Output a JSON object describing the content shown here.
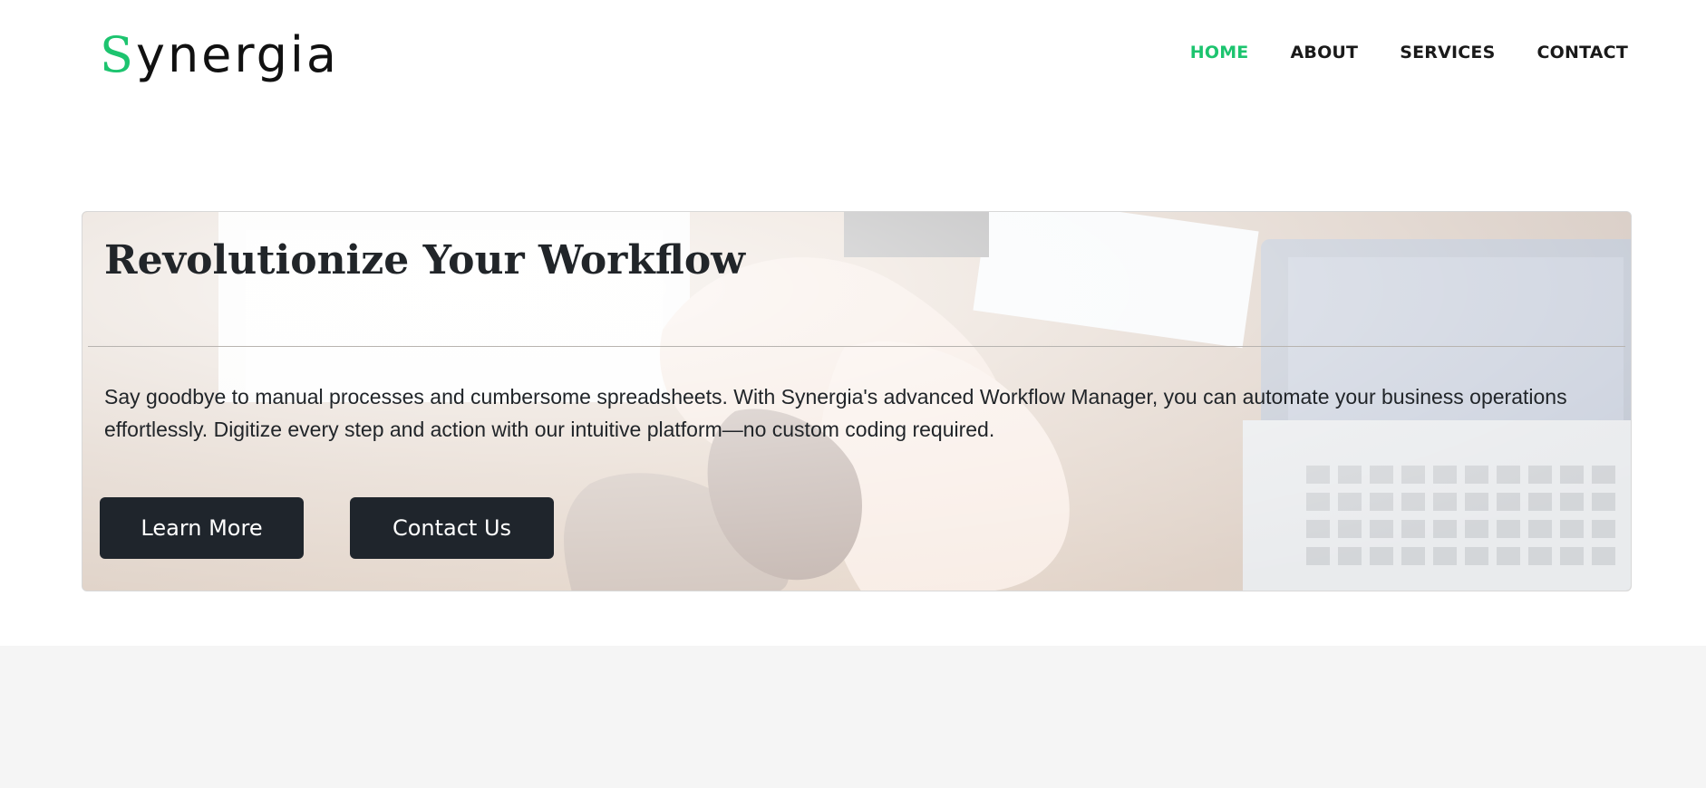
{
  "header": {
    "logo_initial": "S",
    "logo_rest": "ynergia",
    "nav": [
      {
        "label": "HOME",
        "active": true
      },
      {
        "label": "ABOUT",
        "active": false
      },
      {
        "label": "SERVICES",
        "active": false
      },
      {
        "label": "CONTACT",
        "active": false
      }
    ]
  },
  "hero": {
    "title": "Revolutionize Your Workflow",
    "body": "Say goodbye to manual processes and cumbersome spreadsheets. With Synergia's advanced Workflow Manager, you can automate your business operations effortlessly. Digitize every step and action with our intuitive platform—no custom coding required.",
    "primary_button": "Learn More",
    "secondary_button": "Contact Us",
    "background_image": "team-hands-stacked-on-desk-photo"
  },
  "colors": {
    "accent": "#1dc46f",
    "button_bg": "#1f252c",
    "text": "#212529",
    "footer_band": "#f5f5f5"
  }
}
